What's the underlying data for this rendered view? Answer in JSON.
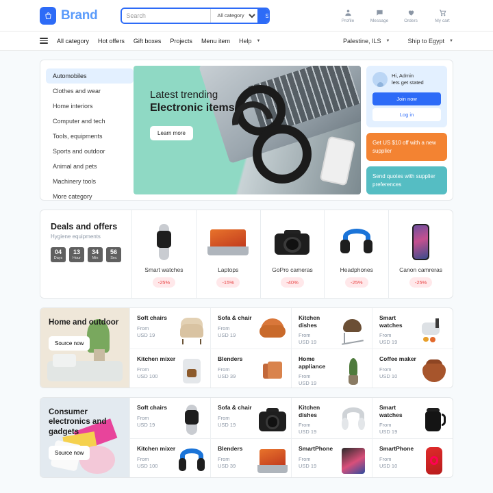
{
  "header": {
    "brand": "Brand",
    "logo_icon": "shopping-bag-icon",
    "search": {
      "placeholder": "Search",
      "value": "",
      "category": "All category",
      "button": "Search"
    },
    "actions": [
      {
        "icon": "profile-icon",
        "label": "Profile"
      },
      {
        "icon": "message-icon",
        "label": "Message"
      },
      {
        "icon": "heart-icon",
        "label": "Orders"
      },
      {
        "icon": "cart-icon",
        "label": "My cart"
      }
    ]
  },
  "nav": {
    "menu_icon": "hamburger-icon",
    "items": [
      "All category",
      "Hot offers",
      "Gift boxes",
      "Projects",
      "Menu item",
      "Help"
    ],
    "locale": "Palestine, ILS",
    "shipping": "Ship to Egypt"
  },
  "hero": {
    "categories": [
      "Automobiles",
      "Clothes and wear",
      "Home interiors",
      "Computer and tech",
      "Tools, equipments",
      "Sports and outdoor",
      "Animal and pets",
      "Machinery tools",
      "More category"
    ],
    "active_category": "Automobiles",
    "banner": {
      "line1": "Latest trending",
      "line2": "Electronic items",
      "button": "Learn more"
    },
    "user": {
      "greeting_line1": "Hi, Admin",
      "greeting_line2": "lets get stated",
      "join_label": "Join now",
      "login_label": "Log in"
    },
    "promos": [
      {
        "text": "Get US $10 off with a new supplier",
        "color": "#F38332"
      },
      {
        "text": "Send quotes with supplier preferences",
        "color": "#55BDC3"
      }
    ]
  },
  "deals": {
    "title": "Deals and offers",
    "subtitle": "Hygiene equipments",
    "timer": [
      {
        "value": "04",
        "unit": "Days"
      },
      {
        "value": "13",
        "unit": "Hour"
      },
      {
        "value": "34",
        "unit": "Min"
      },
      {
        "value": "56",
        "unit": "Sec"
      }
    ],
    "items": [
      {
        "name": "Smart watches",
        "discount": "-25%",
        "img": "watch"
      },
      {
        "name": "Laptops",
        "discount": "-15%",
        "img": "laptop"
      },
      {
        "name": "GoPro cameras",
        "discount": "-40%",
        "img": "camera"
      },
      {
        "name": "Headphones",
        "discount": "-25%",
        "img": "headset"
      },
      {
        "name": "Canon camreras",
        "discount": "-25%",
        "img": "phone"
      }
    ]
  },
  "sections": [
    {
      "title": "Home and outdoor",
      "button": "Source now",
      "bg": "#EFE7D9",
      "products": [
        {
          "name": "Soft chairs",
          "from": "From",
          "price": "USD 19",
          "img": "chair"
        },
        {
          "name": "Sofa & chair",
          "from": "From",
          "price": "USD 19",
          "img": "sofa"
        },
        {
          "name": "Kitchen dishes",
          "from": "From",
          "price": "USD 19",
          "img": "dish"
        },
        {
          "name": "Smart watches",
          "from": "From",
          "price": "USD 19",
          "img": "juicer"
        },
        {
          "name": "Kitchen mixer",
          "from": "From",
          "price": "USD 100",
          "img": "mixer"
        },
        {
          "name": "Blenders",
          "from": "From",
          "price": "USD 39",
          "img": "blender"
        },
        {
          "name": "Home appliance",
          "from": "From",
          "price": "USD 19",
          "img": "plant"
        },
        {
          "name": "Coffee maker",
          "from": "From",
          "price": "USD 10",
          "img": "pot"
        }
      ]
    },
    {
      "title": "Consumer electronics and gadgets",
      "button": "Source now",
      "bg": "#E3EAF0",
      "products": [
        {
          "name": "Soft chairs",
          "from": "From",
          "price": "USD 19",
          "img": "watch"
        },
        {
          "name": "Sofa & chair",
          "from": "From",
          "price": "USD 19",
          "img": "camera"
        },
        {
          "name": "Kitchen dishes",
          "from": "From",
          "price": "USD 19",
          "img": "headphone2"
        },
        {
          "name": "Smart watches",
          "from": "From",
          "price": "USD 19",
          "img": "kettle"
        },
        {
          "name": "Kitchen mixer",
          "from": "From",
          "price": "USD 100",
          "img": "headset"
        },
        {
          "name": "Blenders",
          "from": "From",
          "price": "USD 39",
          "img": "laptop"
        },
        {
          "name": "SmartPhone",
          "from": "From",
          "price": "USD 19",
          "img": "tablet"
        },
        {
          "name": "SmartPhone",
          "from": "From",
          "price": "USD 10",
          "img": "iphone"
        }
      ]
    }
  ]
}
